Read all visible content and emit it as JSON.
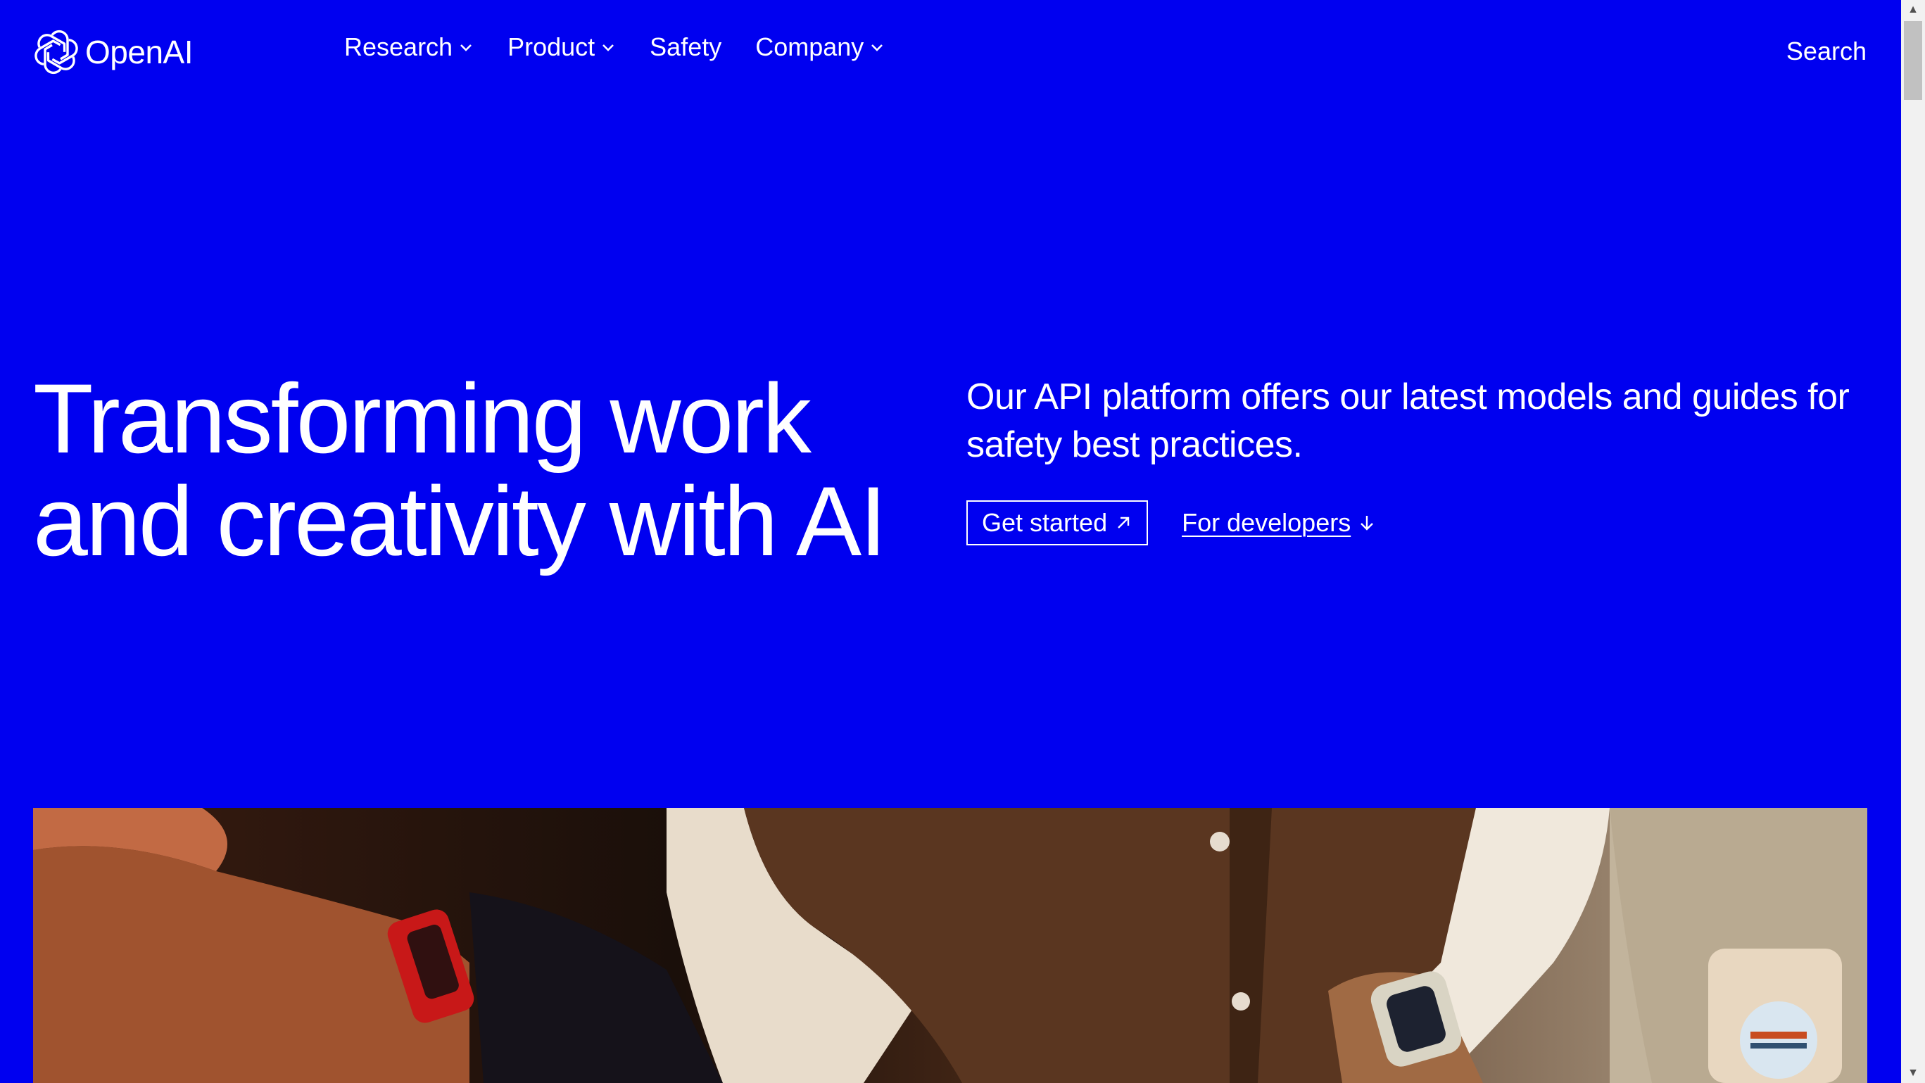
{
  "brand": {
    "name": "OpenAI",
    "logo_icon": "openai-blossom-icon"
  },
  "nav": {
    "items": [
      {
        "label": "Research",
        "has_dropdown": true
      },
      {
        "label": "Product",
        "has_dropdown": true
      },
      {
        "label": "Safety",
        "has_dropdown": false
      },
      {
        "label": "Company",
        "has_dropdown": true
      }
    ],
    "search_label": "Search"
  },
  "hero": {
    "title": "Transforming work and creativity with AI",
    "subtitle": "Our API platform offers our latest models and guides for safety best practices.",
    "primary_cta": {
      "label": "Get started",
      "icon": "arrow-up-right-icon"
    },
    "secondary_cta": {
      "label": "For developers",
      "icon": "arrow-down-icon"
    },
    "image": "people-with-smartwatches-photo"
  },
  "colors": {
    "background": "#0000F0",
    "text": "#FFFFFF"
  }
}
